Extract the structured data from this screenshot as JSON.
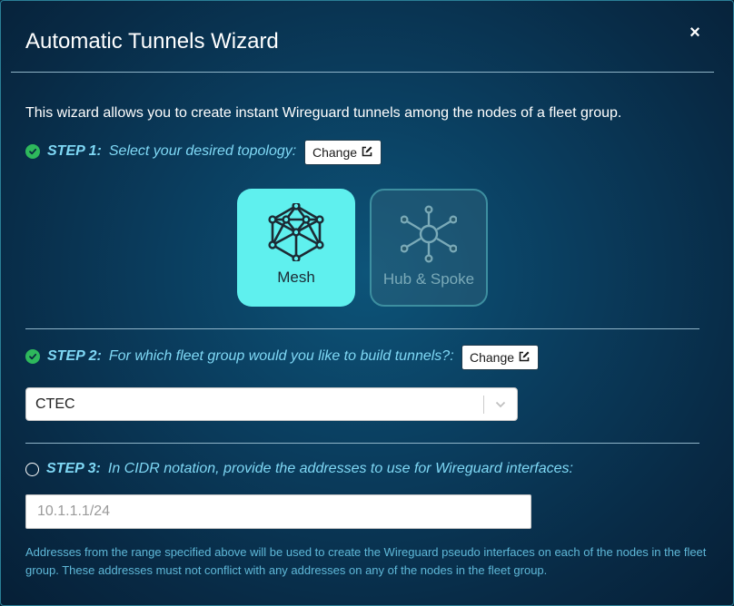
{
  "dialog": {
    "title": "Automatic Tunnels Wizard",
    "close_label": "×"
  },
  "intro": "This wizard allows you to create instant Wireguard tunnels among the nodes of a fleet group.",
  "step1": {
    "number": "STEP 1:",
    "text": "Select your desired topology:",
    "status": "complete",
    "change_label": "Change",
    "options": [
      {
        "label": "Mesh",
        "icon": "mesh-icon",
        "selected": true
      },
      {
        "label": "Hub & Spoke",
        "icon": "hub-spoke-icon",
        "selected": false
      }
    ]
  },
  "step2": {
    "number": "STEP 2:",
    "text": "For which fleet group would you like to build tunnels?:",
    "status": "complete",
    "change_label": "Change",
    "selected_group": "CTEC"
  },
  "step3": {
    "number": "STEP 3:",
    "text": "In CIDR notation, provide the addresses to use for Wireguard interfaces:",
    "status": "pending",
    "input_value": "",
    "input_placeholder": "10.1.1.1/24",
    "help_text": "Addresses from the range specified above will be used to create the Wireguard pseudo interfaces on each of the nodes in the fleet group. These addresses must not conflict with any addresses on any of the nodes in the fleet group."
  },
  "colors": {
    "accent_cyan": "#5ff0ee",
    "step_text": "#7fd8f5",
    "check_green": "#2eb85c",
    "help_text": "#5fb8d8"
  }
}
